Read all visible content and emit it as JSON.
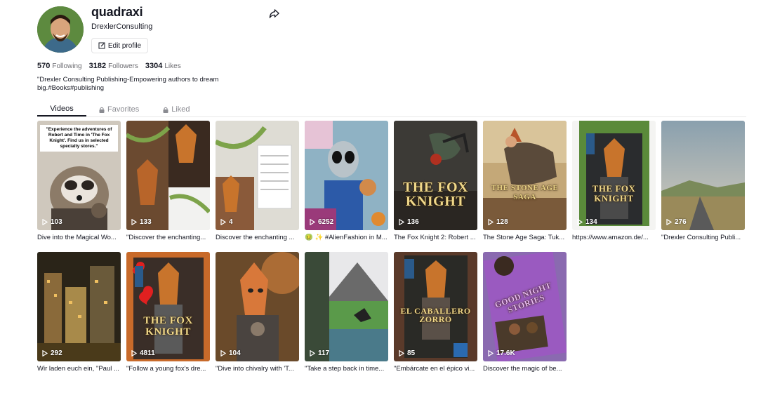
{
  "profile": {
    "username": "quadraxi",
    "nickname": "DrexlerConsulting",
    "edit_label": "Edit profile",
    "stats": [
      {
        "value": "570",
        "label": "Following"
      },
      {
        "value": "3182",
        "label": "Followers"
      },
      {
        "value": "3304",
        "label": "Likes"
      }
    ],
    "bio": "\"Drexler Consulting Publishing-Empowering authors to dream big.#Books#publishing"
  },
  "tabs": [
    {
      "label": "Videos"
    },
    {
      "label": "Favorites"
    },
    {
      "label": "Liked"
    }
  ],
  "videos": [
    {
      "views": "103",
      "caption": "Dive into the Magical Wo...",
      "overlay": "\"Experience the adventures of Robert and Timo in 'The Fox Knight'. Find us in selected specialty stores.\""
    },
    {
      "views": "133",
      "caption": "\"Discover the enchanting..."
    },
    {
      "views": "4",
      "caption": "Discover the enchanting ..."
    },
    {
      "views": "6252",
      "caption": "🤢 ✨ #AlienFashion in M..."
    },
    {
      "views": "136",
      "caption": "The Fox Knight 2: Robert ...",
      "overlay": "THE FOX KNIGHT"
    },
    {
      "views": "128",
      "caption": "The Stone Age Saga: Tuk...",
      "overlay": "THE STONE AGE SAGA"
    },
    {
      "views": "134",
      "caption": "https://www.amazon.de/...",
      "overlay": "THE FOX KNIGHT"
    },
    {
      "views": "276",
      "caption": "\"Drexler Consulting Publi..."
    },
    {
      "views": "292",
      "caption": "Wir laden euch ein, \"Paul ..."
    },
    {
      "views": "4811",
      "caption": "\"Follow a young fox's dre...",
      "overlay": "THE FOX KNIGHT"
    },
    {
      "views": "104",
      "caption": "\"Dive into chivalry with 'T..."
    },
    {
      "views": "117",
      "caption": "\"Take a step back in time..."
    },
    {
      "views": "85",
      "caption": "\"Embárcate en el épico vi...",
      "overlay": "EL CABALLERO ZORRO"
    },
    {
      "views": "17.6K",
      "caption": "Discover the magic of be...",
      "overlay": "GOOD NIGHT STORIES"
    }
  ]
}
